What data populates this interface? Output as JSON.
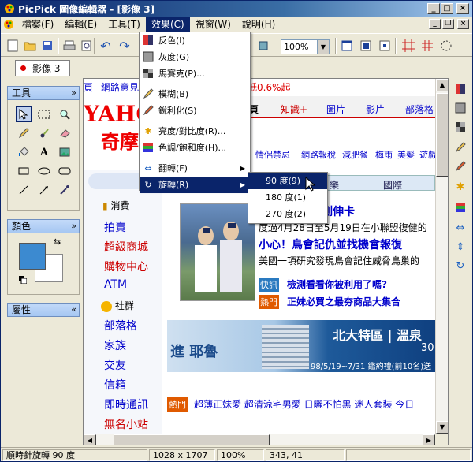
{
  "window": {
    "title": "PicPick 圖像編輯器 - [影像 3]",
    "buttons": {
      "minimize": "_",
      "maximize": "□",
      "close": "×"
    }
  },
  "menubar": {
    "items": [
      "檔案(F)",
      "編輯(E)",
      "工具(T)",
      "效果(C)",
      "視窗(W)",
      "說明(H)"
    ],
    "active_index": 3
  },
  "toolbar": {
    "zoom": "100%"
  },
  "tabs": [
    {
      "label": "影像 3"
    }
  ],
  "left_panel": {
    "tools_title": "工具",
    "color_title": "顏色",
    "properties_title": "屬性",
    "primary_color": "#3c8ad0",
    "secondary_color": "#ffffff"
  },
  "effects_menu": {
    "items": [
      {
        "label": "反色(I)",
        "icon": "invert-icon"
      },
      {
        "label": "灰度(G)",
        "icon": "grayscale-icon"
      },
      {
        "label": "馬賽克(P)...",
        "icon": "mosaic-icon"
      },
      {
        "label": "模糊(B)",
        "icon": "blur-icon"
      },
      {
        "label": "銳利化(S)",
        "icon": "sharpen-icon"
      },
      {
        "label": "亮度/對比度(R)...",
        "icon": "brightness-icon"
      },
      {
        "label": "色調/飽和度(H)...",
        "icon": "hue-icon"
      },
      {
        "label": "翻轉(F)",
        "icon": "flip-icon"
      },
      {
        "label": "旋轉(R)",
        "icon": "rotate-icon"
      }
    ]
  },
  "rotate_submenu": {
    "items": [
      "90 度(9)",
      "180 度(1)",
      "270 度(2)"
    ]
  },
  "webpage": {
    "top_links": [
      "頁",
      "網路意見",
      "低0.6%起"
    ],
    "nav_tabs": [
      "頁",
      "知識+",
      "圖片",
      "影片",
      "部落格"
    ],
    "hot_links": [
      "情侶禁忌",
      "網路報稅",
      "減肥餐",
      "梅雨",
      "美髮",
      "遊戲"
    ],
    "sub_tabs": [
      "樂",
      "國際"
    ],
    "left_nav_heading1": "消費",
    "left_nav_items1": [
      "拍賣",
      "超級商城",
      "購物中心",
      "ATM"
    ],
    "left_nav_heading2": "社群",
    "left_nav_items2": [
      "部落格",
      "家族",
      "交友",
      "信箱",
      "即時通訊",
      "無名小站"
    ],
    "news_headline": "進牛棚測伸卡",
    "news_body": "度過4月28日至5月19日在小聯盟復健的",
    "headline2": "小心！鳥會記仇並找機會報復",
    "body2": "美國一項研究發現鳥會記住威脅鳥巢的",
    "tag1": "快訊",
    "quick1": "檢測看看你被利用了嗎?",
    "tag2": "熱門",
    "quick2": "正妹必買之最夯商品大集合",
    "banner_title": "北大特區 | 溫泉",
    "banner_sub": "進 耶魯",
    "banner_date": "98/5/19~7/31 鑑約禮(前10名)送",
    "banner_num": "30",
    "tag3": "熱門",
    "bottom_line": "超薄正妹愛 超清涼宅男愛 日曬不怕黑 迷人套裝 今日",
    "yahoo_logo": "YAHOO!",
    "yahoo_sub": "奇摩"
  },
  "status": {
    "message": "順時針旋轉 90 度",
    "size": "1028 x 1707",
    "zoom": "100%",
    "coords": "343, 41"
  }
}
